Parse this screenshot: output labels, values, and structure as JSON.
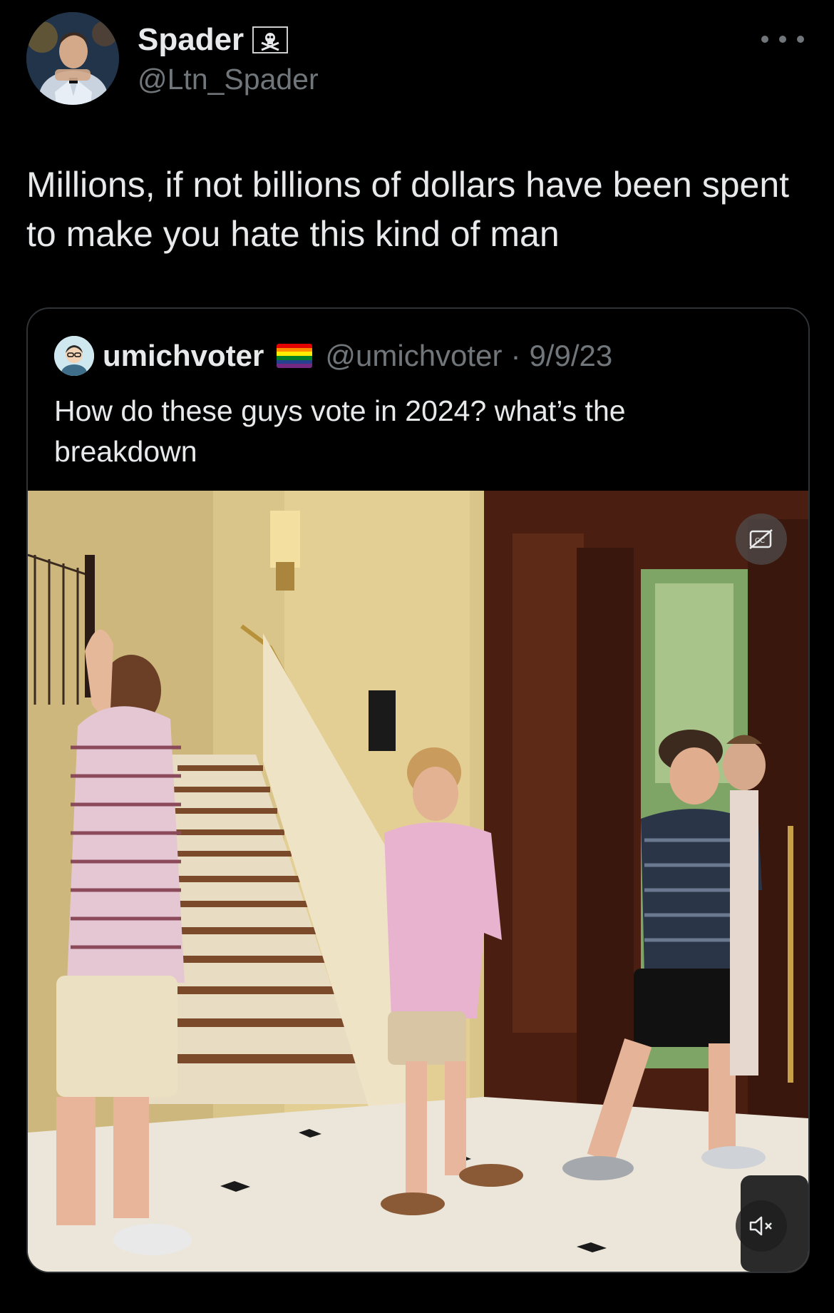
{
  "author": {
    "display_name": "Spader",
    "handle": "@Ltn_Spader",
    "badge_icon": "pirate-flag-icon",
    "avatar_icon": "profile-photo"
  },
  "more_icon": "more-horizontal-icon",
  "tweet": {
    "text": "Millions, if not billions of dollars have been spent to make you hate this kind  of man"
  },
  "quote": {
    "display_name": "umichvoter",
    "badge_icon": "rainbow-flag-icon",
    "handle": "@umichvoter",
    "separator": "·",
    "date": "9/9/23",
    "text": "How do these guys vote in 2024? what’s the breakdown"
  },
  "video": {
    "captions_icon": "captions-off-icon",
    "mute_icon": "speaker-muted-icon"
  },
  "colors": {
    "background": "#000000",
    "text_primary": "#e7e9ea",
    "text_secondary": "#71767b",
    "card_border": "#2f3336"
  }
}
